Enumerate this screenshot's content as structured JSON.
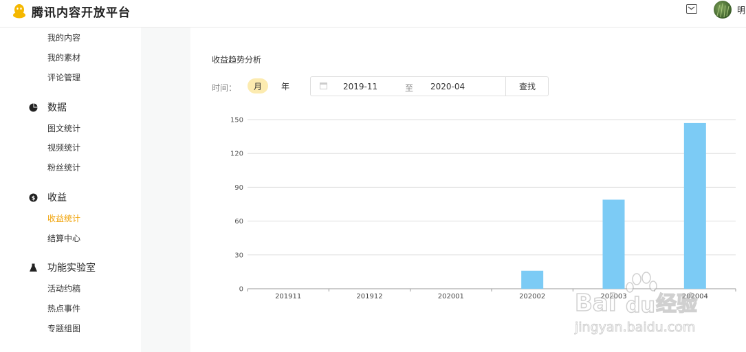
{
  "header": {
    "brand": "腾讯内容开放平台",
    "username": "明",
    "brand_color": "#f5b800"
  },
  "sidebar": {
    "top_items": [
      "我的内容",
      "我的素材",
      "评论管理"
    ],
    "groups": [
      {
        "label": "数据",
        "icon": "pie-chart-icon",
        "items": [
          "图文统计",
          "视频统计",
          "粉丝统计"
        ]
      },
      {
        "label": "收益",
        "icon": "money-icon",
        "items": [
          "收益统计",
          "结算中心"
        ]
      },
      {
        "label": "功能实验室",
        "icon": "flask-icon",
        "items": [
          "活动约稿",
          "热点事件",
          "专题组图"
        ]
      }
    ],
    "active_item": "收益统计",
    "active_color": "#f0a000"
  },
  "main": {
    "section_title": "收益趋势分析",
    "time_label": "时间：",
    "period_options": [
      "月",
      "年"
    ],
    "period_selected": "月",
    "date_start": "2019-11",
    "date_separator": "至",
    "date_end": "2020-04",
    "search_label": "查找"
  },
  "chart_data": {
    "type": "bar",
    "categories": [
      "201911",
      "201912",
      "202001",
      "202002",
      "202003",
      "202004"
    ],
    "values": [
      0,
      0,
      0,
      16,
      79,
      147
    ],
    "yticks": [
      0,
      30,
      60,
      90,
      120,
      150
    ],
    "ylim": [
      0,
      150
    ],
    "grid": true,
    "bar_color": "#7ccbf5"
  },
  "watermark": {
    "brand": "Bai",
    "brand_suffix": "du",
    "cn": "经验",
    "url": "jingyan.baidu.com"
  }
}
